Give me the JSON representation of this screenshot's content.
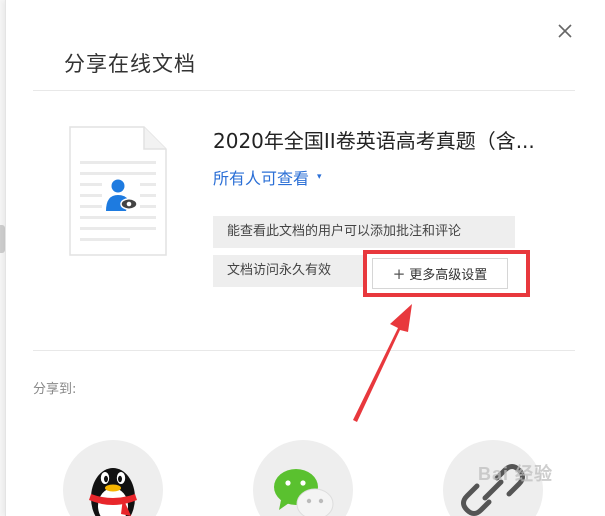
{
  "dialog": {
    "title": "分享在线文档",
    "close_icon": "close-icon"
  },
  "document": {
    "title": "2020年全国II卷英语高考真题（含...",
    "icon": "document-shared-view-icon"
  },
  "permission": {
    "label": "所有人可查看",
    "caret": "▾"
  },
  "info": {
    "comment_permission": "能查看此文档的用户可以添加批注和评论",
    "access_duration": "文档访问永久有效"
  },
  "advanced_button": {
    "plus": "+",
    "label": "更多高级设置"
  },
  "share": {
    "label": "分享到:",
    "targets": [
      {
        "name": "qq",
        "icon": "qq-icon"
      },
      {
        "name": "wechat",
        "icon": "wechat-icon"
      },
      {
        "name": "link",
        "icon": "link-icon"
      }
    ]
  },
  "colors": {
    "link_blue": "#2b6fd6",
    "annotation_red": "#e8383d",
    "doc_person_blue": "#1e7be0"
  },
  "watermark": {
    "text": "Bai 经验"
  }
}
